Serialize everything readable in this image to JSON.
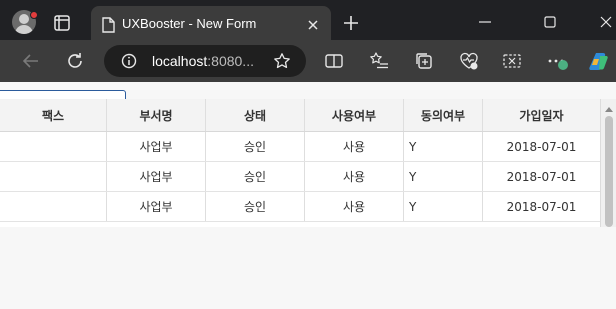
{
  "browser": {
    "tab_title": "UXBooster - New Form",
    "url_host": "localhost",
    "url_rest": ":8080...",
    "icons": {
      "profile": "avatar-icon",
      "tab_actions": "tab-actions-icon",
      "favicon": "page-icon",
      "close_tab": "close-icon",
      "new_tab": "plus-icon",
      "minimize": "minimize-icon",
      "maximize": "maximize-icon",
      "close_window": "close-icon",
      "back": "back-arrow-icon",
      "reload": "reload-icon",
      "site_info": "info-icon",
      "favorite": "star-icon",
      "split_screen": "split-screen-icon",
      "favorites": "favorites-list-icon",
      "collections": "collections-icon",
      "browser_essentials": "heart-pulse-icon",
      "screenshot": "screenshot-icon",
      "more": "more-icon",
      "copilot": "copilot-icon"
    },
    "colors": {
      "tabbar": "#202124",
      "toolbar": "#3c3c3c",
      "profile_badge": "#e23d3d"
    }
  },
  "filter": {
    "select_value": ""
  },
  "grid": {
    "columns": [
      "팩스",
      "부서명",
      "상태",
      "사용여부",
      "동의여부",
      "가입일자"
    ],
    "rows": [
      {
        "fax": "",
        "dept": "사업부",
        "status": "승인",
        "use": "사용",
        "agree": "Y",
        "joined": "2018-07-01"
      },
      {
        "fax": "",
        "dept": "사업부",
        "status": "승인",
        "use": "사용",
        "agree": "Y",
        "joined": "2018-07-01"
      },
      {
        "fax": "",
        "dept": "사업부",
        "status": "승인",
        "use": "사용",
        "agree": "Y",
        "joined": "2018-07-01"
      }
    ]
  }
}
